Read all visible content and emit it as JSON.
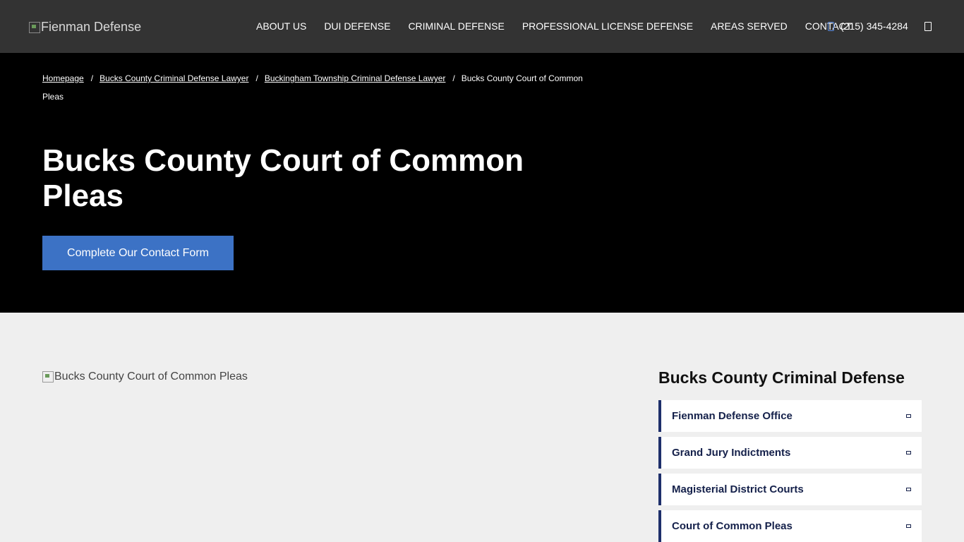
{
  "header": {
    "logo_alt": "Fienman Defense",
    "nav": [
      {
        "label": "ABOUT US"
      },
      {
        "label": "DUI DEFENSE"
      },
      {
        "label": "CRIMINAL DEFENSE"
      },
      {
        "label": "PROFESSIONAL LICENSE DEFENSE"
      },
      {
        "label": "AREAS SERVED"
      },
      {
        "label": "CONTACT"
      }
    ],
    "phone": "(215) 345-4284",
    "phone_icon": "phone-icon",
    "menu_icon": "menu-icon"
  },
  "hero": {
    "breadcrumb": [
      {
        "label": "Homepage"
      },
      {
        "label": "Bucks County Criminal Defense Lawyer"
      },
      {
        "label": "Buckingham Township Criminal Defense Lawyer"
      }
    ],
    "breadcrumb_current": "Bucks County Court of Common Pleas",
    "breadcrumb_separator": "/",
    "title": "Bucks County Court of Common Pleas",
    "cta_label": "Complete Our Contact Form"
  },
  "main": {
    "image_alt": "Bucks County Court of Common Pleas"
  },
  "sidebar": {
    "title": "Bucks County Criminal Defense",
    "items": [
      {
        "label": "Fienman Defense Office"
      },
      {
        "label": "Grand Jury Indictments"
      },
      {
        "label": "Magisterial District Courts"
      },
      {
        "label": "Court of Common Pleas"
      }
    ]
  },
  "colors": {
    "header_bg": "#333333",
    "hero_bg": "#000000",
    "accent": "#3c72c5",
    "sidebar_border": "#1e2f6b",
    "page_bg": "#efefef"
  }
}
